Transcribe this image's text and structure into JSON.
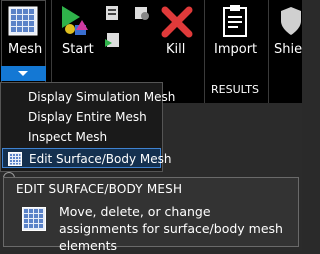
{
  "ribbon": {
    "buttons": [
      {
        "label": "Mesh",
        "icon": "mesh-grid-icon"
      },
      {
        "label": "Start",
        "icon": "start-simulation-icon"
      },
      {
        "label": "Kill",
        "icon": "kill-x-icon"
      },
      {
        "label": "Import",
        "icon": "import-clipboard-icon"
      },
      {
        "label": "Shie",
        "icon": "shield-icon"
      }
    ],
    "group_labels": {
      "results": "RESULTS"
    }
  },
  "menu": {
    "items": [
      {
        "label": "Display Simulation Mesh"
      },
      {
        "label": "Display Entire Mesh"
      },
      {
        "label": "Inspect Mesh"
      },
      {
        "label": "Edit Surface/Body Mesh",
        "highlighted": true
      }
    ]
  },
  "tooltip": {
    "title": "EDIT SURFACE/BODY MESH",
    "description": "Move, delete, or change assignments for surface/body mesh elements"
  },
  "colors": {
    "accent": "#1478d4",
    "ribbon_bg": "#000000",
    "kill_red": "#e03a3a",
    "start_green": "#2fb24a"
  }
}
